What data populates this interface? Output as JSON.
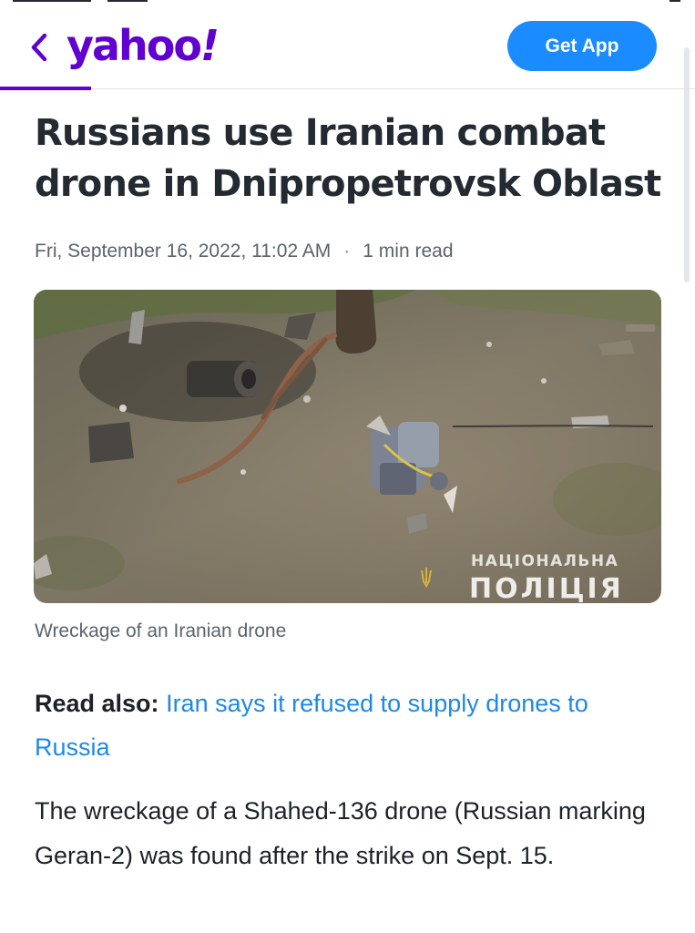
{
  "header": {
    "logo_text": "yahoo",
    "logo_bang": "!",
    "get_app_label": "Get App",
    "brand_color": "#6001d2",
    "button_color": "#1a8cff"
  },
  "article": {
    "title": "Russians use Iranian combat drone in Dnipropetrovsk Oblast",
    "date": "Fri, September 16, 2022, 11:02 AM",
    "separator": "·",
    "read_time": "1 min read",
    "image": {
      "watermark_line1": "НАЦІОНАЛЬНА",
      "watermark_line2": "ПОЛІЦІЯ"
    },
    "caption": "Wreckage of an Iranian drone",
    "read_also_label": "Read also:",
    "read_also_link": "Iran says it refused to supply drones to Russia",
    "link_color": "#1e88e5",
    "body": "The wreckage of a Shahed-136 drone (Russian marking Geran-2) was found after the strike on Sept. 15."
  },
  "icons": {
    "back": "chevron-left-icon",
    "emblem": "trident-emblem-icon"
  }
}
